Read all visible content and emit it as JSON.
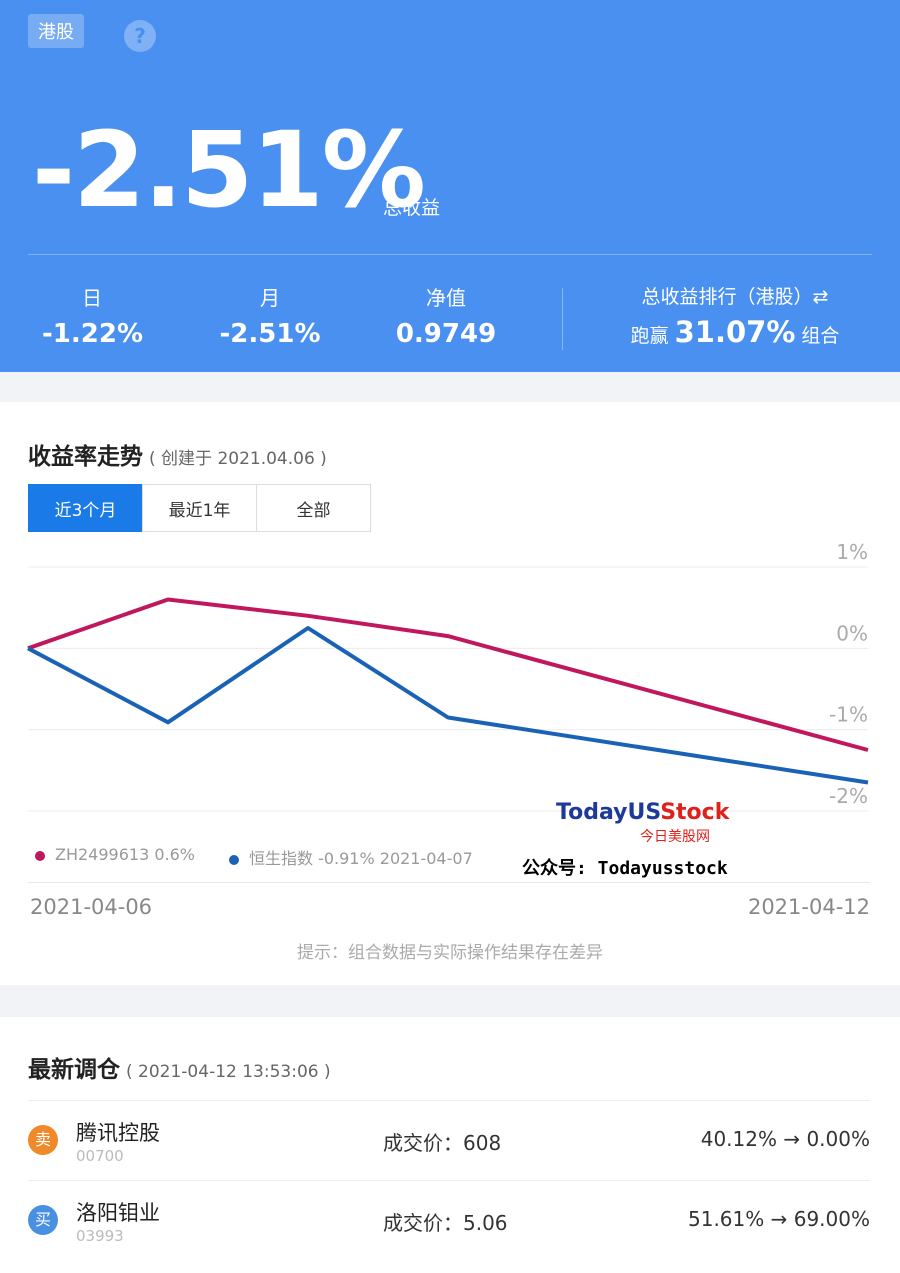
{
  "header": {
    "market_tag": "港股",
    "help_icon": "?",
    "total_return": "-2.51%",
    "total_return_label": "总收益",
    "stats": [
      {
        "label": "日",
        "value": "-1.22%"
      },
      {
        "label": "月",
        "value": "-2.51%"
      },
      {
        "label": "净值",
        "value": "0.9749"
      }
    ],
    "rank_label": "总收益排行（港股）⇄",
    "rank_prefix": "跑赢",
    "rank_percent": "31.07%",
    "rank_suffix": "组合"
  },
  "trend": {
    "title": "收益率走势",
    "created": "( 创建于 2021.04.06 )",
    "tabs": [
      "近3个月",
      "最近1年",
      "全部"
    ],
    "active_tab": 0,
    "legend": [
      {
        "text": "ZH2499613 0.6%",
        "color": "#c0175d"
      },
      {
        "text": "恒生指数 -0.91% 2021-04-07",
        "color": "#1a62b5"
      }
    ],
    "date_start": "2021-04-06",
    "date_end": "2021-04-12",
    "hint": "提示：组合数据与实际操作结果存在差异"
  },
  "chart_data": {
    "type": "line",
    "x": [
      "2021-04-06",
      "2021-04-07",
      "2021-04-08",
      "2021-04-09",
      "2021-04-12"
    ],
    "series": [
      {
        "name": "ZH2499613",
        "color": "#c0175d",
        "values": [
          0,
          0.6,
          0.4,
          0.15,
          -1.25
        ]
      },
      {
        "name": "恒生指数",
        "color": "#1a62b5",
        "values": [
          0,
          -0.91,
          0.25,
          -0.85,
          -1.65
        ]
      }
    ],
    "ylim": [
      -2,
      1
    ],
    "yticks": [
      1,
      0,
      -1,
      -2
    ],
    "ytick_labels": [
      "1%",
      "0%",
      "-1%",
      "-2%"
    ],
    "grid": true
  },
  "watermark": {
    "brand_a": "TodayUS",
    "brand_b": "Stock",
    "sub": "今日美股网",
    "account": "公众号: Todayusstock"
  },
  "trades": {
    "title": "最新调仓",
    "time": "( 2021-04-12 13:53:06 )",
    "items": [
      {
        "badge": "卖",
        "badge_color": "#f0892a",
        "name": "腾讯控股",
        "code": "00700",
        "price_label": "成交价：",
        "price": "608",
        "change": "40.12% → 0.00%"
      },
      {
        "badge": "买",
        "badge_color": "#4a90e2",
        "name": "洛阳钼业",
        "code": "03993",
        "price_label": "成交价：",
        "price": "5.06",
        "change": "51.61% → 69.00%"
      }
    ]
  }
}
